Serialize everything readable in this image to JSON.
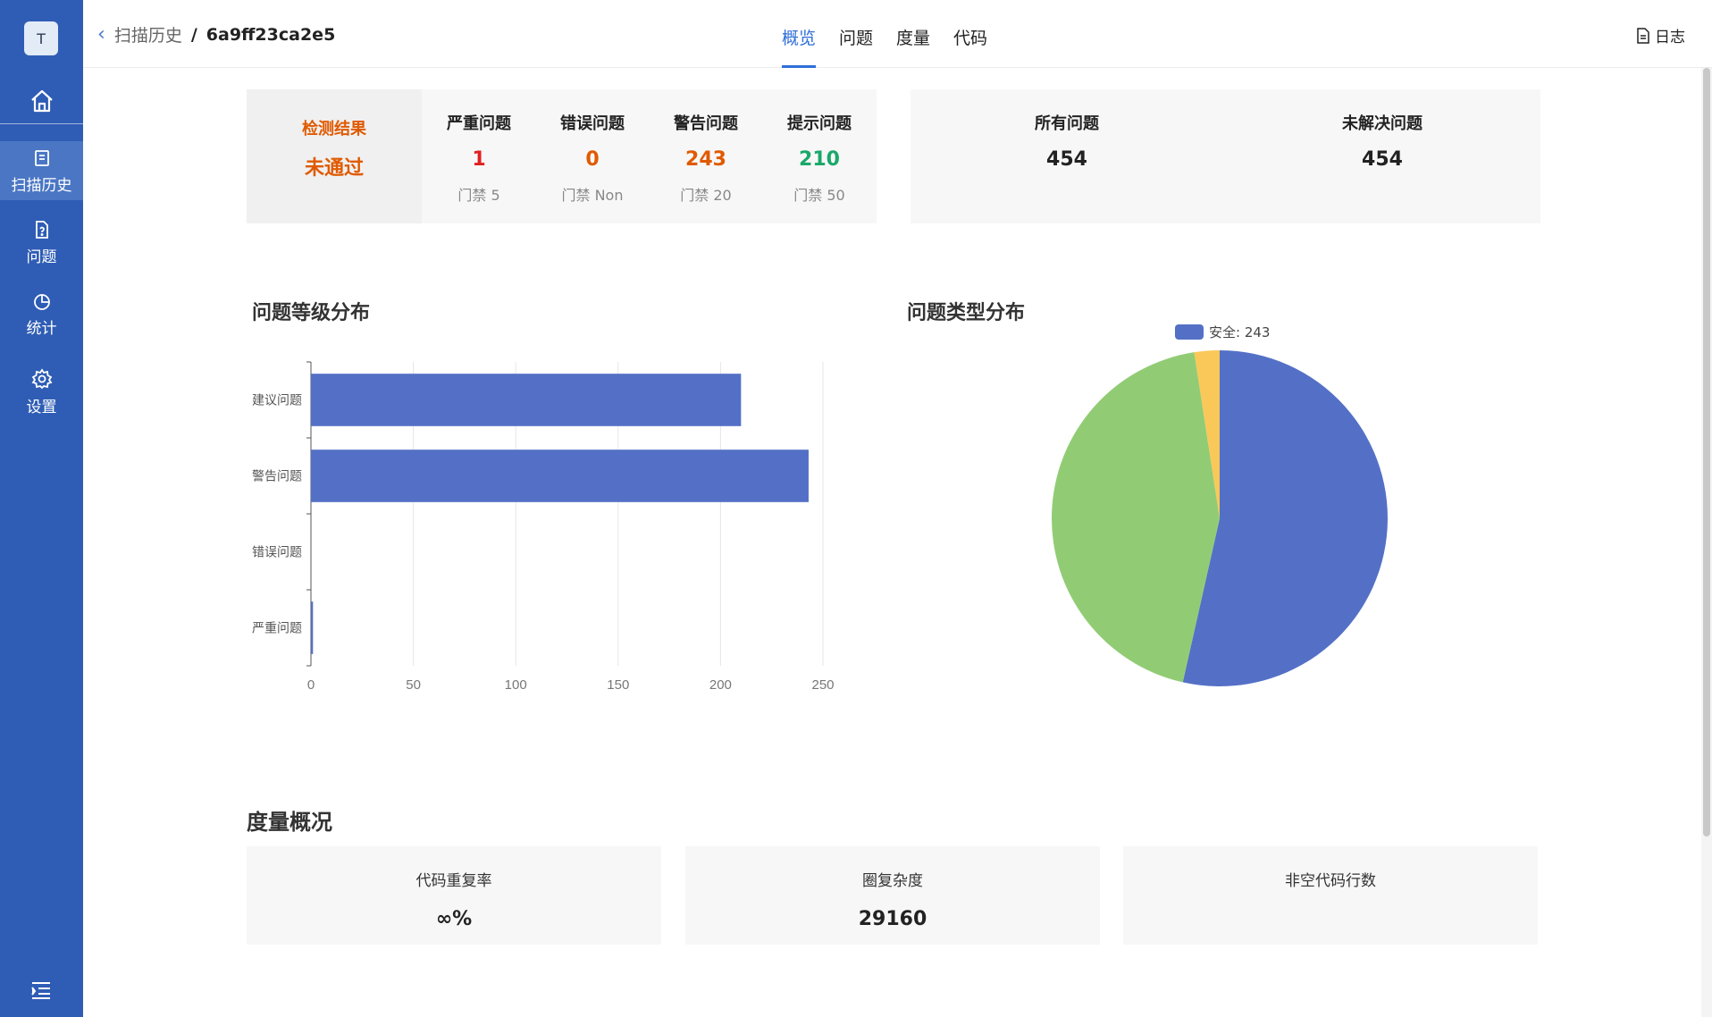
{
  "sidebar": {
    "avatar": "T",
    "items": [
      {
        "label": "扫描历史",
        "active": true
      },
      {
        "label": "问题",
        "active": false
      },
      {
        "label": "统计",
        "active": false
      },
      {
        "label": "设置",
        "active": false
      }
    ]
  },
  "header": {
    "breadcrumb_parent": "扫描历史",
    "separator": "/",
    "breadcrumb_current": "6a9ff23ca2e5",
    "tabs": [
      "概览",
      "问题",
      "度量",
      "代码"
    ],
    "active_tab": "概览",
    "log_label": "日志"
  },
  "summary": {
    "result_title": "检测结果",
    "result_value": "未通过",
    "metrics": [
      {
        "name": "严重问题",
        "value": "1",
        "gate": "门禁 5",
        "color": "#e02020"
      },
      {
        "name": "错误问题",
        "value": "0",
        "gate": "门禁 Non",
        "color": "#e05a00"
      },
      {
        "name": "警告问题",
        "value": "243",
        "gate": "门禁 20",
        "color": "#e05a00"
      },
      {
        "name": "提示问题",
        "value": "210",
        "gate": "门禁 50",
        "color": "#1aa86a"
      }
    ],
    "totals": [
      {
        "name": "所有问题",
        "value": "454"
      },
      {
        "name": "未解决问题",
        "value": "454"
      }
    ]
  },
  "level_chart": {
    "title": "问题等级分布"
  },
  "type_chart": {
    "title": "问题类型分布",
    "legend_text": "安全: 243"
  },
  "chart_data": [
    {
      "type": "bar",
      "orientation": "horizontal",
      "title": "问题等级分布",
      "categories": [
        "建议问题",
        "警告问题",
        "错误问题",
        "严重问题"
      ],
      "values": [
        210,
        243,
        0,
        1
      ],
      "xlim": [
        0,
        250
      ],
      "xticks": [
        0,
        50,
        100,
        150,
        200,
        250
      ],
      "grid": true,
      "color": "#5470c6"
    },
    {
      "type": "pie",
      "title": "问题类型分布",
      "legend": "top",
      "slices": [
        {
          "value": 243,
          "color": "#5470c6"
        },
        {
          "value": 200,
          "color": "#91cc75"
        },
        {
          "value": 11,
          "color": "#fac858"
        }
      ],
      "legend_entries": [
        {
          "text": "安全: 243",
          "color": "#5470c6"
        }
      ]
    }
  ],
  "measures": {
    "title": "度量概况",
    "cards": [
      {
        "name": "代码重复率",
        "value": "∞%"
      },
      {
        "name": "圈复杂度",
        "value": "29160"
      },
      {
        "name": "非空代码行数",
        "value": ""
      }
    ]
  }
}
